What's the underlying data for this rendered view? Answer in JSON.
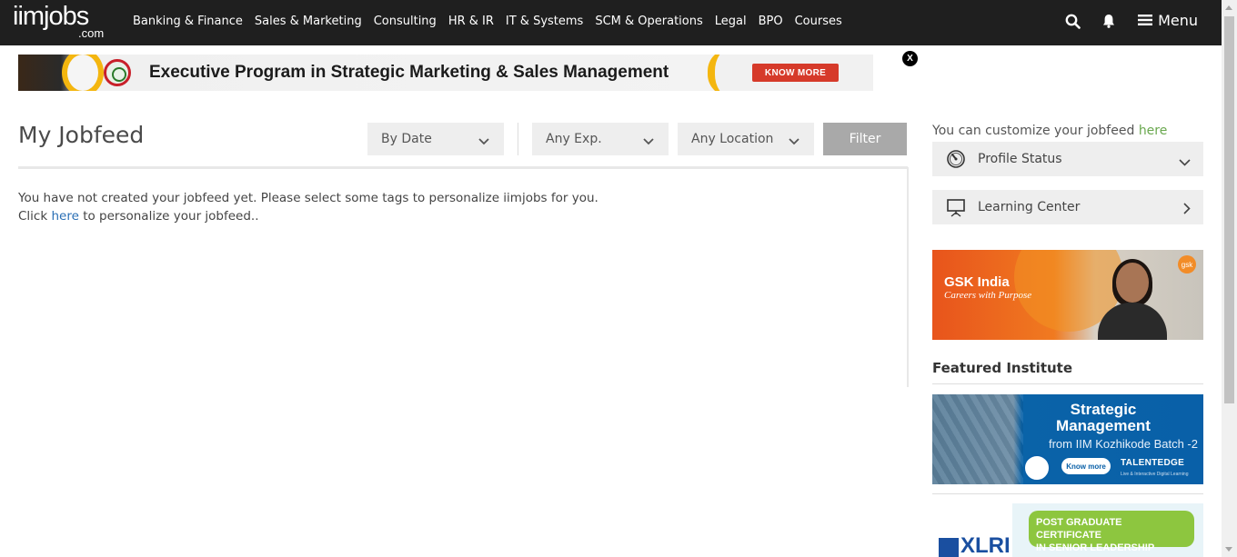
{
  "brand": {
    "name": "iimjobs",
    "suffix": ".com"
  },
  "nav": {
    "links": [
      "Banking & Finance",
      "Sales & Marketing",
      "Consulting",
      "HR & IR",
      "IT & Systems",
      "SCM & Operations",
      "Legal",
      "BPO",
      "Courses"
    ],
    "menu_label": "Menu",
    "icons": [
      "search-icon",
      "bell-icon",
      "hamburger-icon"
    ]
  },
  "ad_banner": {
    "text": "Executive Program in Strategic Marketing & Sales Management",
    "button": "KNOW MORE",
    "close": "X"
  },
  "main": {
    "title": "My Jobfeed",
    "sort_select": "By Date",
    "exp_select": "Any Exp.",
    "location_select": "Any Location",
    "filter_button": "Filter",
    "message_line1": "You have not created your jobfeed yet. Please select some tags to personalize iimjobs for you.",
    "message_click": "Click",
    "message_link": "here",
    "message_rest": "to personalize your jobfeed.."
  },
  "sidebar": {
    "customize_text": "You can customize your jobfeed",
    "customize_link": "here",
    "profile_status": "Profile Status",
    "learning_center": "Learning Center",
    "gsk_ad": {
      "title": "GSK India",
      "tagline": "Careers with Purpose",
      "logo": "gsk"
    },
    "featured_title": "Featured Institute",
    "featured_ad": {
      "headline_1": "Strategic",
      "headline_2": "Management",
      "subline": "from IIM Kozhikode Batch -2",
      "button": "Know more",
      "brand": "TALENTEDGE",
      "brand_sub": "Live & Interactive Digital Learning"
    },
    "xlri_ad": {
      "logo": "XLRI",
      "pill_line1": "POST GRADUATE CERTIFICATE",
      "pill_line2": "IN SENIOR LEADERSHIP"
    }
  },
  "colors": {
    "nav_bg": "#1f1f1f",
    "link_blue": "#2a6fb5",
    "link_green": "#6aa84f",
    "filter_bg": "#a9a9a9"
  }
}
